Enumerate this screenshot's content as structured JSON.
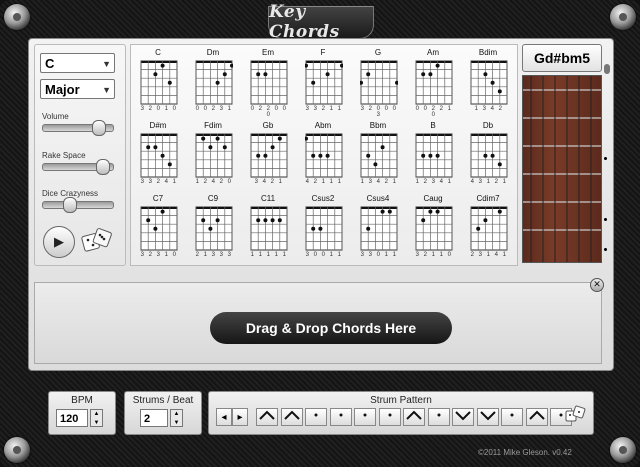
{
  "app": {
    "title": "Key Chords"
  },
  "key_select": {
    "value": "C"
  },
  "mode_select": {
    "value": "Major"
  },
  "sliders": {
    "volume": {
      "label": "Volume",
      "level": 0.85
    },
    "rake": {
      "label": "Rake Space",
      "level": 0.92
    },
    "dice": {
      "label": "Dice Crazyness",
      "level": 0.35
    }
  },
  "chords": [
    {
      "name": "C",
      "fingers": "3 2 0 1 0"
    },
    {
      "name": "Dm",
      "fingers": "0 0 2 3 1"
    },
    {
      "name": "Em",
      "fingers": "0 2 2 0 0 0"
    },
    {
      "name": "F",
      "fingers": "3 3 2 1 1"
    },
    {
      "name": "G",
      "fingers": "3 2 0 0 0 3"
    },
    {
      "name": "Am",
      "fingers": "0 0 2 2 1 0"
    },
    {
      "name": "Bdim",
      "fingers": "1 3 4 2"
    },
    {
      "name": "D#m",
      "fingers": "3 3 2 4 1"
    },
    {
      "name": "Fdim",
      "fingers": "1 2 4 2 0"
    },
    {
      "name": "Gb",
      "fingers": "3 4 2 1"
    },
    {
      "name": "Abm",
      "fingers": "4 2 1 1 1"
    },
    {
      "name": "Bbm",
      "fingers": "1 3 4 2 1"
    },
    {
      "name": "B",
      "fingers": "1 2 3 4 1"
    },
    {
      "name": "Db",
      "fingers": "4 3 1 2 1"
    },
    {
      "name": "C7",
      "fingers": "3 2 3 1 0"
    },
    {
      "name": "C9",
      "fingers": "2 1 3 3 3"
    },
    {
      "name": "C11",
      "fingers": "1 1 1 1 1"
    },
    {
      "name": "Csus2",
      "fingers": "3 0 0 1 1"
    },
    {
      "name": "Csus4",
      "fingers": "3 3 0 1 1"
    },
    {
      "name": "Caug",
      "fingers": "3 2 1 1 0"
    },
    {
      "name": "Cdim7",
      "fingers": "2 3 1 4 1"
    }
  ],
  "current_chord": "Gd#bm5",
  "dropzone": {
    "label": "Drag & Drop Chords Here",
    "close": "✕"
  },
  "bpm": {
    "label": "BPM",
    "value": "120"
  },
  "strums": {
    "label": "Strums / Beat",
    "value": "2"
  },
  "strum_pattern": {
    "label": "Strum Pattern",
    "prev": "◂",
    "next": "▸",
    "steps": [
      "up",
      "up",
      "dot",
      "dot",
      "dot",
      "dot",
      "up",
      "dot",
      "down",
      "down",
      "dot",
      "up",
      "dot"
    ]
  },
  "spin": {
    "up": "▲",
    "down": "▼"
  },
  "footer": {
    "copyright": "©2011 Mike Gleson. v0.42"
  }
}
